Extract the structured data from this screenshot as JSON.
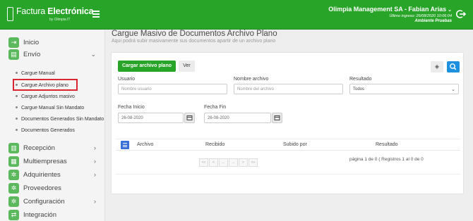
{
  "header": {
    "logo_light": "Factura ",
    "logo_bold": "Electrónica",
    "logo_sub": "by Olimpia IT",
    "company_user": "Olimpia Management SA - Fabian Arias",
    "last_login": "Último ingreso: 26/08/2020 10:06:04",
    "environment": "Ambiente Pruebas",
    "brand_color": "#28a428"
  },
  "sidebar": {
    "items": [
      {
        "label": "Inicio",
        "icon": "exit-icon"
      },
      {
        "label": "Envío",
        "icon": "send-icon",
        "expanded": true
      },
      {
        "label": "Recepción",
        "icon": "inbox-icon"
      },
      {
        "label": "Multiempresas",
        "icon": "building-icon"
      },
      {
        "label": "Adquirientes",
        "icon": "cog-icon"
      },
      {
        "label": "Proveedores",
        "icon": "cog-icon"
      },
      {
        "label": "Configuración",
        "icon": "cog-icon"
      },
      {
        "label": "Integración",
        "icon": "shuffle-icon"
      }
    ],
    "envio_subitems": [
      {
        "label": "Cargue Manual"
      },
      {
        "label": "Cargue Archivo plano",
        "selected": true
      },
      {
        "label": "Cargue Adjuntos masivo"
      },
      {
        "label": "Cargue Manual Sin Mandato"
      },
      {
        "label": "Documentos Generados Sin Mandato"
      },
      {
        "label": "Documentos Generados"
      }
    ]
  },
  "main": {
    "title": "Cargue Masivo de Documentos Archivo Plano",
    "subtitle": "Aqui podrá subir masivamente sus documentos apartir de un archivo plano",
    "buttons": {
      "upload": "Cargar archivo plano",
      "view": "Ver"
    },
    "filters": {
      "usuario_label": "Usuario",
      "usuario_placeholder": "Nombre usuario",
      "archivo_label": "Nombre archivo",
      "archivo_placeholder": "Nombre del archivo",
      "resultado_label": "Resultado",
      "resultado_value": "Todos",
      "fecha_inicio_label": "Fecha Inicio",
      "fecha_inicio_value": "26-08-2020",
      "fecha_fin_label": "Fecha Fin",
      "fecha_fin_value": "26-08-2020"
    },
    "table": {
      "columns": [
        "Archivo",
        "Recibido",
        "Subido por",
        "Resultado"
      ]
    },
    "pager": {
      "buttons": [
        "<<",
        "<",
        "...",
        "...",
        ">",
        ">>"
      ],
      "info": "página 1 de 0 ( Registros 1 al 0 de 0"
    }
  }
}
